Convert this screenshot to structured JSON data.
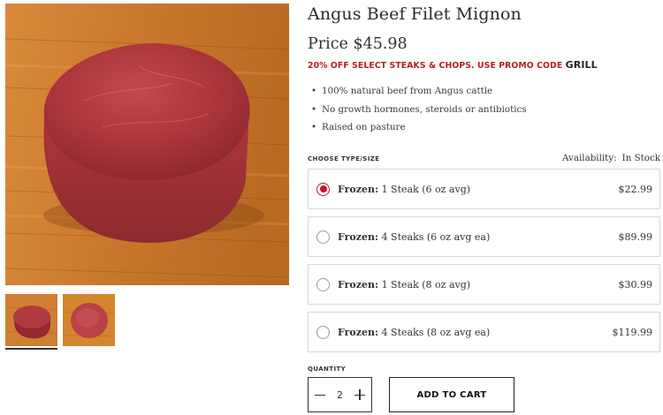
{
  "product": {
    "title": "Angus Beef Filet Mignon",
    "price_label": "Price $45.98",
    "promo_text": "20% OFF SELECT STEAKS & CHOPS. USE PROMO CODE",
    "promo_code": "GRILL",
    "features": [
      "100% natural beef from Angus cattle",
      "No growth hormones, steroids or antibiotics",
      "Raised on pasture"
    ]
  },
  "gallery": {
    "main_image": "filet-mignon-on-cutting-board",
    "thumbnails": [
      "filet-side-view",
      "filet-top-view"
    ],
    "active_thumbnail": 0
  },
  "options_section": {
    "label": "CHOOSE TYPE/SIZE",
    "availability_label": "Availability:",
    "availability_value": "In Stock",
    "options": [
      {
        "type": "Frozen:",
        "desc": "1 Steak (6 oz avg)",
        "price": "$22.99",
        "selected": true
      },
      {
        "type": "Frozen:",
        "desc": "4 Steaks (6 oz avg ea)",
        "price": "$89.99",
        "selected": false
      },
      {
        "type": "Frozen:",
        "desc": "1 Steak (8 oz avg)",
        "price": "$30.99",
        "selected": false
      },
      {
        "type": "Frozen:",
        "desc": "4 Steaks (8 oz avg ea)",
        "price": "$119.99",
        "selected": false
      }
    ]
  },
  "quantity": {
    "label": "QUANTITY",
    "value": "2"
  },
  "cart": {
    "add_label": "ADD TO CART"
  },
  "colors": {
    "accent_red": "#b31f24",
    "radio_selected": "#c8102e",
    "border": "#d8d8d8"
  }
}
